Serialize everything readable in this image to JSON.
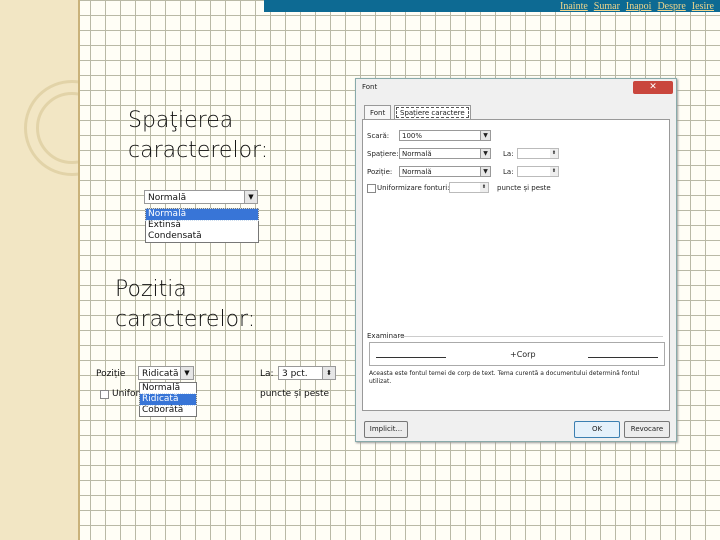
{
  "nav": {
    "inainte": "Inainte",
    "sumar": "Sumar",
    "inapoi": "Inapoi",
    "despre": "Despre",
    "iesire": "Iesire"
  },
  "slide": {
    "heading1_line1": "Spaţierea",
    "heading1_line2": "caracterelor:",
    "heading2_line1": "Pozitia",
    "heading2_line2": "caracterelor:"
  },
  "spacing_snippet": {
    "current": "Normală",
    "options": [
      "Normală",
      "Extinsă",
      "Condensată"
    ],
    "selected_index": 0
  },
  "position_snippet": {
    "position_label": "Poziție",
    "position_value": "Ridicată",
    "la_label": "La:",
    "la_value": "3 pct.",
    "uniform_label": "Uniform",
    "puncte_label": "puncte și peste",
    "options": [
      "Normală",
      "Ridicată",
      "Coborâtă"
    ],
    "selected_index": 1
  },
  "dialog": {
    "title": "Font",
    "tabs": [
      "Font",
      "Spațiere caractere"
    ],
    "active_tab": 1,
    "scara_label": "Scară:",
    "scara_value": "100%",
    "spatiere_label": "Spațiere:",
    "spatiere_value": "Normală",
    "pozitie_label": "Poziție:",
    "pozitie_value": "Normală",
    "la_label_1": "La:",
    "la_label_2": "La:",
    "kerning_label": "Uniformizare fonturi:",
    "kerning_suffix": "puncte și peste",
    "preview_label": "Examinare",
    "preview_text": "+Corp",
    "preview_note": "Aceasta este fontul temei de corp de text. Tema curentă a documentului determină fontul utilizat.",
    "default_button": "Implicit...",
    "ok_button": "OK",
    "cancel_button": "Revocare"
  }
}
